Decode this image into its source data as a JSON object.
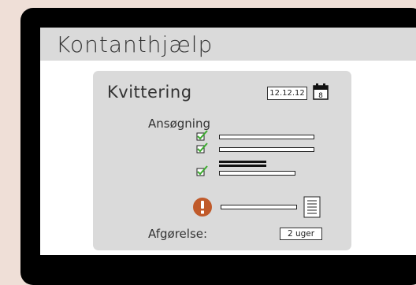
{
  "app": {
    "title": "Kontanthjælp"
  },
  "receipt": {
    "title": "Kvittering",
    "date": "12.12.12",
    "calendar_day": "8",
    "section_label": "Ansøgning",
    "decision_label": "Afgørelse:",
    "decision_time": "2 uger"
  },
  "colors": {
    "check": "#3cab2f",
    "alert": "#c05a2a",
    "card": "#dadada",
    "background": "#efdfd7"
  },
  "icons": [
    "check-icon",
    "alert-icon",
    "document-icon",
    "calendar-icon"
  ]
}
